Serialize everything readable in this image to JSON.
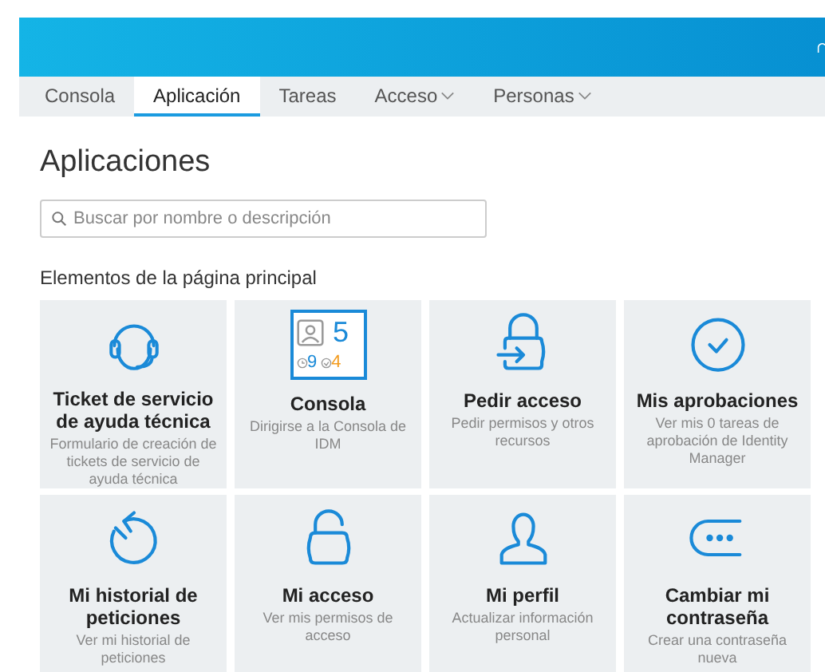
{
  "tabs": [
    {
      "label": "Consola",
      "selected": false,
      "has_menu": false
    },
    {
      "label": "Aplicación",
      "selected": true,
      "has_menu": false
    },
    {
      "label": "Tareas",
      "selected": false,
      "has_menu": false
    },
    {
      "label": "Acceso",
      "selected": false,
      "has_menu": true
    },
    {
      "label": "Personas",
      "selected": false,
      "has_menu": true
    }
  ],
  "page_title": "Aplicaciones",
  "search": {
    "placeholder": "Buscar por nombre o descripción"
  },
  "section_title": "Elementos de la página principal",
  "tiles": [
    {
      "kind": "headset",
      "title": "Ticket de servicio de ayuda técnica",
      "description": "Formulario de creación de tickets de servicio de ayuda técnica"
    },
    {
      "kind": "console",
      "title": "Consola",
      "description": "Dirigirse a la Consola de IDM",
      "counts": {
        "total": "5",
        "pending": "9",
        "done": "4"
      }
    },
    {
      "kind": "lock-enter",
      "title": "Pedir acceso",
      "description": "Pedir permisos y otros recursos"
    },
    {
      "kind": "check-circle",
      "title": "Mis aprobaciones",
      "description": "Ver mis 0 tareas de aprobación de Identity Manager"
    },
    {
      "kind": "history",
      "title": "Mi historial de peticiones",
      "description": "Ver mi historial de peticiones"
    },
    {
      "kind": "lock-open",
      "title": "Mi acceso",
      "description": "Ver mis permisos de acceso"
    },
    {
      "kind": "person",
      "title": "Mi perfil",
      "description": "Actualizar información personal"
    },
    {
      "kind": "password",
      "title": "Cambiar mi contraseña",
      "description": "Crear una contraseña nueva"
    }
  ]
}
